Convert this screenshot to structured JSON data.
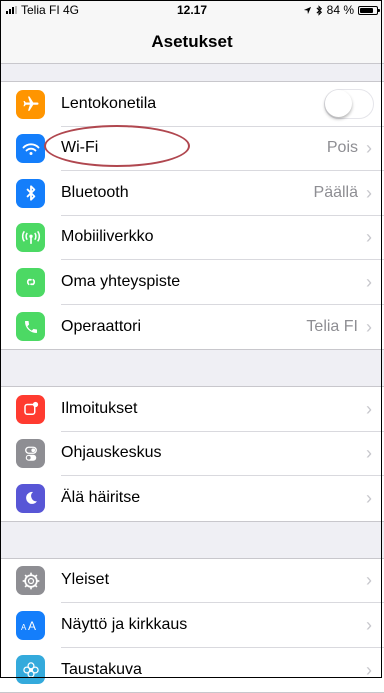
{
  "statusbar": {
    "carrier": "Telia FI  4G",
    "time": "12.17",
    "battery": "84 %",
    "battery_level": 0.84
  },
  "navbar": {
    "title": "Asetukset"
  },
  "groups": [
    {
      "rows": [
        {
          "label": "Lentokonetila",
          "icon": "airplane-icon",
          "color": "#ff9500",
          "toggle_on": false
        },
        {
          "label": "Wi-Fi",
          "icon": "wifi-icon",
          "color": "#147efb",
          "value": "Pois"
        },
        {
          "label": "Bluetooth",
          "icon": "bluetooth-icon",
          "color": "#147efb",
          "value": "Päällä"
        },
        {
          "label": "Mobiiliverkko",
          "icon": "cellular-icon",
          "color": "#4cd964",
          "value": ""
        },
        {
          "label": "Oma yhteyspiste",
          "icon": "hotspot-icon",
          "color": "#4cd964",
          "value": ""
        },
        {
          "label": "Operaattori",
          "icon": "phone-icon",
          "color": "#4cd964",
          "value": "Telia FI"
        }
      ]
    },
    {
      "rows": [
        {
          "label": "Ilmoitukset",
          "icon": "notifications-icon",
          "color": "#ff3b30",
          "value": ""
        },
        {
          "label": "Ohjauskeskus",
          "icon": "control-center-icon",
          "color": "#8e8e93",
          "value": ""
        },
        {
          "label": "Älä häiritse",
          "icon": "moon-icon",
          "color": "#5856d6",
          "value": ""
        }
      ]
    },
    {
      "rows": [
        {
          "label": "Yleiset",
          "icon": "gear-icon",
          "color": "#8e8e93",
          "value": ""
        },
        {
          "label": "Näyttö ja kirkkaus",
          "icon": "display-brightness-icon",
          "color": "#147efb",
          "value": ""
        },
        {
          "label": "Taustakuva",
          "icon": "wallpaper-icon",
          "color": "#34aadc",
          "value": ""
        }
      ]
    }
  ]
}
